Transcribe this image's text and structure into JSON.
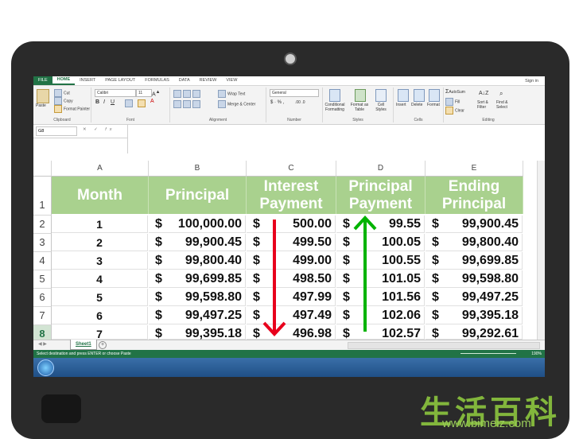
{
  "ribbon": {
    "tabs": [
      "FILE",
      "HOME",
      "INSERT",
      "PAGE LAYOUT",
      "FORMULAS",
      "DATA",
      "REVIEW",
      "VIEW"
    ],
    "sign_in": "Sign in",
    "clipboard": {
      "paste": "Paste",
      "cut": "Cut",
      "copy": "Copy",
      "format_painter": "Format Painter",
      "name": "Clipboard"
    },
    "font": {
      "family": "Calibri",
      "size": "11",
      "name": "Font"
    },
    "alignment": {
      "wrap": "Wrap Text",
      "merge": "Merge & Center",
      "name": "Alignment"
    },
    "number": {
      "format": "General",
      "name": "Number"
    },
    "styles": {
      "conditional": "Conditional Formatting",
      "format_table": "Format as Table",
      "cell_styles": "Cell Styles",
      "name": "Styles"
    },
    "cells": {
      "insert": "Insert",
      "delete": "Delete",
      "format": "Format",
      "name": "Cells"
    },
    "editing": {
      "autosum": "AutoSum",
      "fill": "Fill",
      "clear": "Clear",
      "sort": "Sort & Filter",
      "find": "Find & Select",
      "name": "Editing"
    }
  },
  "formula_bar": {
    "name_box": "G8",
    "fx": "fx"
  },
  "columns": [
    "A",
    "B",
    "C",
    "D",
    "E"
  ],
  "rows": [
    "1",
    "2",
    "3",
    "4",
    "5",
    "6",
    "7",
    "8"
  ],
  "headers": [
    "Month",
    "Principal",
    "Interest Payment",
    "Principal Payment",
    "Ending Principal"
  ],
  "table": [
    {
      "month": "1",
      "principal": "100,000.00",
      "interest": "500.00",
      "pp": "99.55",
      "ending": "99,900.45"
    },
    {
      "month": "2",
      "principal": "99,900.45",
      "interest": "499.50",
      "pp": "100.05",
      "ending": "99,800.40"
    },
    {
      "month": "3",
      "principal": "99,800.40",
      "interest": "499.00",
      "pp": "100.55",
      "ending": "99,699.85"
    },
    {
      "month": "4",
      "principal": "99,699.85",
      "interest": "498.50",
      "pp": "101.05",
      "ending": "99,598.80"
    },
    {
      "month": "5",
      "principal": "99,598.80",
      "interest": "497.99",
      "pp": "101.56",
      "ending": "99,497.25"
    },
    {
      "month": "6",
      "principal": "99,497.25",
      "interest": "497.49",
      "pp": "102.06",
      "ending": "99,395.18"
    },
    {
      "month": "7",
      "principal": "99,395.18",
      "interest": "496.98",
      "pp": "102.57",
      "ending": "99,292.61"
    }
  ],
  "currency_symbol": "$",
  "sheet_tab": "Sheet1",
  "status_message": "Select destination and press ENTER or choose Paste",
  "zoom": "190%",
  "colors": {
    "header_green": "#a9d18e",
    "excel_green": "#217346",
    "arrow_red": "#e8001c",
    "arrow_green": "#00b300"
  },
  "watermark": {
    "chars": "生活百科",
    "url": "www.bimeiz.com"
  }
}
